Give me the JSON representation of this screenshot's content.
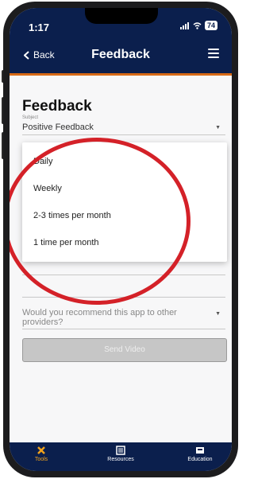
{
  "status": {
    "time": "1:17",
    "battery": "74"
  },
  "nav": {
    "back_label": "Back",
    "title": "Feedback"
  },
  "form": {
    "heading": "Feedback",
    "subject_label": "Subject",
    "subject_value": "Positive Feedback",
    "options": [
      "Daily",
      "Weekly",
      "2-3 times per month",
      "1 time per month"
    ],
    "question": "Would you recommend this app to other providers?",
    "submit_label": "Send Video"
  },
  "tabs": [
    {
      "label": "Tools",
      "icon": "tools-icon",
      "active": true
    },
    {
      "label": "Resources",
      "icon": "resources-icon",
      "active": false
    },
    {
      "label": "Education",
      "icon": "education-icon",
      "active": false
    }
  ],
  "colors": {
    "navy": "#0b1f4d",
    "accent": "#d86a16",
    "tab_active": "#f2a21b",
    "annotation": "#d42128"
  }
}
